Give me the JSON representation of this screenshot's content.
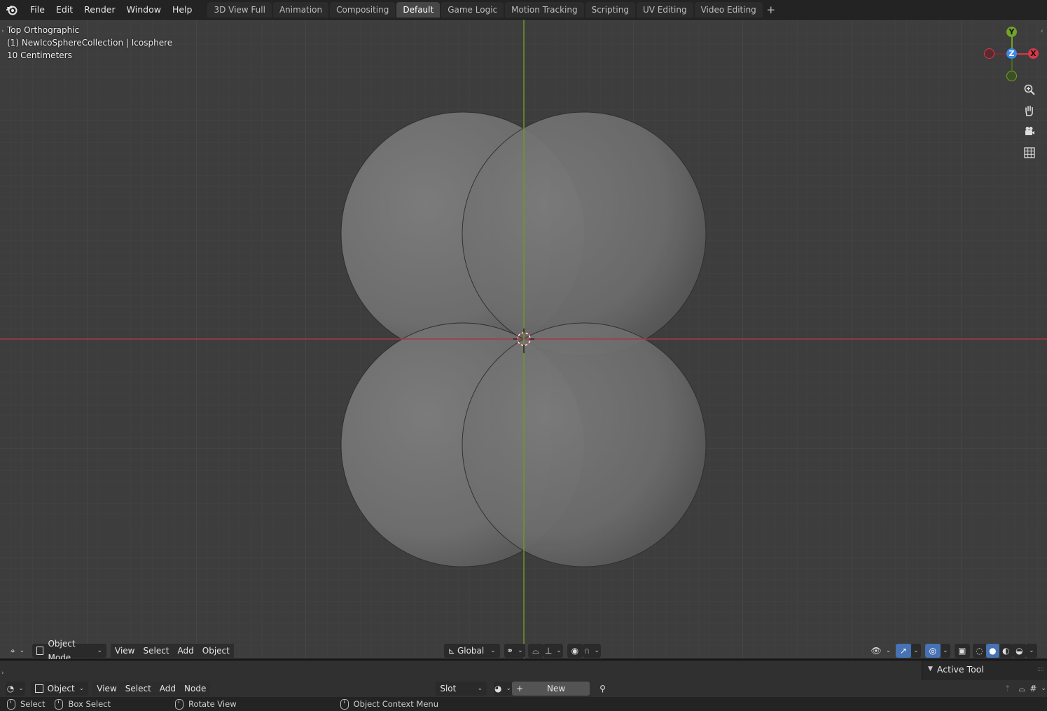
{
  "menu": [
    "File",
    "Edit",
    "Render",
    "Window",
    "Help"
  ],
  "workspaces": {
    "tabs": [
      "3D View Full",
      "Animation",
      "Compositing",
      "Default",
      "Game Logic",
      "Motion Tracking",
      "Scripting",
      "UV Editing",
      "Video Editing"
    ],
    "active": "Default",
    "add_label": "+"
  },
  "viewport": {
    "view_name": "Top Orthographic",
    "collection_line": "(1) NewIcoSphereCollection | Icosphere",
    "scale_line": "10 Centimeters",
    "axis_colors": {
      "x": "#d9384a",
      "y": "#72a32a",
      "z": "#3b8be6"
    },
    "gizmo": {
      "x": "X",
      "y": "Y",
      "z": "Z"
    }
  },
  "viewport_header": {
    "mode": "Object Mode",
    "menus": [
      "View",
      "Select",
      "Add",
      "Object"
    ],
    "transform_orientation": "Global"
  },
  "shader_editor": {
    "active_tool_title": "Active Tool",
    "object_type": "Object",
    "menus": [
      "View",
      "Select",
      "Add",
      "Node"
    ],
    "slot": "Slot",
    "new_label": "New"
  },
  "statusbar": {
    "items": [
      "Select",
      "Box Select",
      "Rotate View",
      "Object Context Menu"
    ]
  }
}
